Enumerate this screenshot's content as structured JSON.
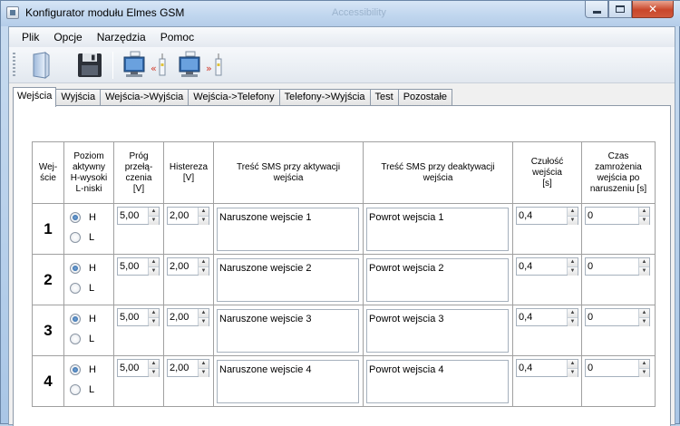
{
  "window": {
    "title": "Konfigurator modułu Elmes GSM",
    "background_title": "Accessibility"
  },
  "menu": [
    "Plik",
    "Opcje",
    "Narzędzia",
    "Pomoc"
  ],
  "toolbar": {
    "buttons": [
      "open-icon",
      "save-icon",
      "read-from-device-icon",
      "write-to-device-icon"
    ]
  },
  "tabs": [
    {
      "label": "Wejścia",
      "active": true
    },
    {
      "label": "Wyjścia"
    },
    {
      "label": "Wejścia->Wyjścia"
    },
    {
      "label": "Wejścia->Telefony"
    },
    {
      "label": "Telefony->Wyjścia"
    },
    {
      "label": "Test"
    },
    {
      "label": "Pozostałe"
    }
  ],
  "table": {
    "headers": {
      "input": "Wej-\nście",
      "level": "Poziom\naktywny\nH-wysoki\nL-niski",
      "threshold": "Próg\nprzełą-\nczenia\n[V]",
      "hysteresis": "Histereza\n[V]",
      "sms_on": "Treść SMS przy aktywacji\nwejścia",
      "sms_off": "Treść SMS przy deaktywacji\nwejścia",
      "sensitivity": "Czułość\nwejścia\n[s]",
      "freeze": "Czas\nzamrożenia\nwejścia po\nnaruszeniu [s]"
    },
    "radio_labels": {
      "high": "H",
      "low": "L"
    },
    "rows": [
      {
        "num": "1",
        "level": "H",
        "threshold": "5,00",
        "hysteresis": "2,00",
        "sms_on": "Naruszone wejscie 1",
        "sms_off": "Powrot wejscia 1",
        "sensitivity": "0,4",
        "freeze": "0"
      },
      {
        "num": "2",
        "level": "H",
        "threshold": "5,00",
        "hysteresis": "2,00",
        "sms_on": "Naruszone wejscie 2",
        "sms_off": "Powrot wejscia 2",
        "sensitivity": "0,4",
        "freeze": "0"
      },
      {
        "num": "3",
        "level": "H",
        "threshold": "5,00",
        "hysteresis": "2,00",
        "sms_on": "Naruszone wejscie 3",
        "sms_off": "Powrot wejscia 3",
        "sensitivity": "0,4",
        "freeze": "0"
      },
      {
        "num": "4",
        "level": "H",
        "threshold": "5,00",
        "hysteresis": "2,00",
        "sms_on": "Naruszone wejscie 4",
        "sms_off": "Powrot wejscia 4",
        "sensitivity": "0,4",
        "freeze": "0"
      }
    ]
  }
}
